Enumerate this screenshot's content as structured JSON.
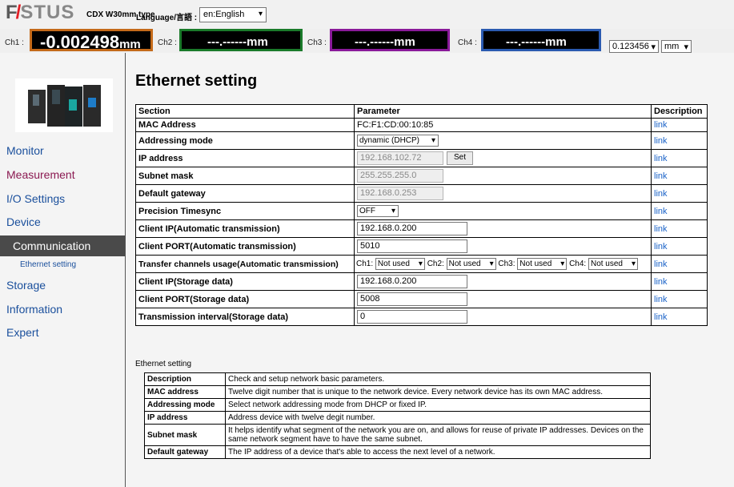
{
  "header": {
    "logo": "FASTUS",
    "model": "CDX W30mm type",
    "language_label": "Language/言語 :",
    "language_value": "en:English"
  },
  "channels": [
    {
      "label": "Ch1 :",
      "value": "-0.002498",
      "unit": "mm",
      "border": "#c46a1a"
    },
    {
      "label": "Ch2 :",
      "value": "---.------",
      "unit": "mm",
      "border": "#1a7a2a"
    },
    {
      "label": "Ch3 :",
      "value": "---.------",
      "unit": "mm",
      "border": "#8a1a9a"
    },
    {
      "label": "Ch4 :",
      "value": "---.------",
      "unit": "mm",
      "border": "#2a5ab0"
    }
  ],
  "precision_select": "0.123456",
  "unit_select": "mm",
  "sidebar": {
    "items": [
      "Monitor",
      "Measurement",
      "I/O Settings",
      "Device",
      "Communication",
      "Storage",
      "Information",
      "Expert"
    ],
    "active": "Communication",
    "subitem": "Ethernet setting"
  },
  "page_title": "Ethernet setting",
  "table": {
    "headers": [
      "Section",
      "Parameter",
      "Description"
    ],
    "link_text": "link",
    "mac": {
      "label": "MAC Address",
      "value": "FC:F1:CD:00:10:85"
    },
    "addressing": {
      "label": "Addressing mode",
      "value": "dynamic (DHCP)"
    },
    "ip": {
      "label": "IP address",
      "value": "192.168.102.72",
      "button": "Set"
    },
    "subnet": {
      "label": "Subnet mask",
      "value": "255.255.255.0"
    },
    "gateway": {
      "label": "Default gateway",
      "value": "192.168.0.253"
    },
    "timesync": {
      "label": "Precision Timesync",
      "value": "OFF"
    },
    "client_ip_auto": {
      "label": "Client IP(Automatic transmission)",
      "value": "192.168.0.200"
    },
    "client_port_auto": {
      "label": "Client PORT(Automatic transmission)",
      "value": "5010"
    },
    "transfer": {
      "label": "Transfer channels usage(Automatic transmission)",
      "ch1_label": "Ch1:",
      "ch1": "Not used",
      "ch2_label": "Ch2:",
      "ch2": "Not used",
      "ch3_label": "Ch3:",
      "ch3": "Not used",
      "ch4_label": "Ch4:",
      "ch4": "Not used"
    },
    "client_ip_storage": {
      "label": "Client IP(Storage data)",
      "value": "192.168.0.200"
    },
    "client_port_storage": {
      "label": "Client PORT(Storage data)",
      "value": "5008"
    },
    "interval": {
      "label": "Transmission interval(Storage data)",
      "value": "0"
    }
  },
  "desc_title": "Ethernet setting",
  "desc": [
    {
      "k": "Description",
      "v": "Check and setup network basic parameters."
    },
    {
      "k": "MAC address",
      "v": "Twelve digit number that is unique to the network device. Every network device has its own MAC address."
    },
    {
      "k": "Addressing mode",
      "v": "Select network addressing mode from DHCP or fixed IP."
    },
    {
      "k": "IP address",
      "v": "Address device with twelve degit number."
    },
    {
      "k": "Subnet mask",
      "v": "It helps identify what segment of the network you are on, and allows for reuse of private IP addresses. Devices on the same network segment have to have the same subnet."
    },
    {
      "k": "Default gateway",
      "v": "The IP address of a device that's able to access the next level of a network."
    }
  ]
}
